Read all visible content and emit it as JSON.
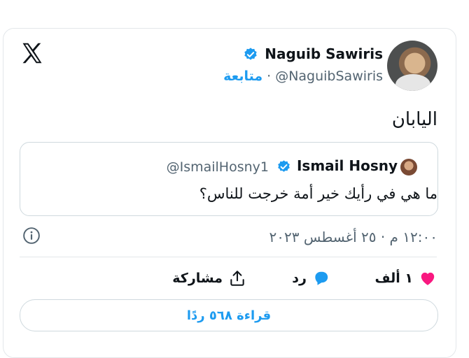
{
  "post": {
    "author_name": "Naguib Sawiris",
    "author_handle": "@NaguibSawiris",
    "follow_label": "متابعة",
    "separator": "·",
    "text": "اليابان",
    "timestamp": "١٢:٠٠ م · ٢٥ أغسطس ٢٠٢٣"
  },
  "quoted": {
    "author_name": "Ismail Hosny",
    "author_handle": "@IsmailHosny1",
    "text": "ما هي في رأيك خير أمة خرجت للناس؟"
  },
  "actions": {
    "likes": "١ ألف",
    "reply": "رد",
    "share": "مشاركة"
  },
  "read_replies": "قراءة ٥٦٨ ردًا",
  "icons": [
    "x-logo-icon",
    "verified-badge-icon",
    "info-icon",
    "heart-icon",
    "reply-bubble-icon",
    "share-icon"
  ],
  "colors": {
    "accent": "#1d9bf0",
    "like": "#f91880",
    "muted": "#536471"
  }
}
